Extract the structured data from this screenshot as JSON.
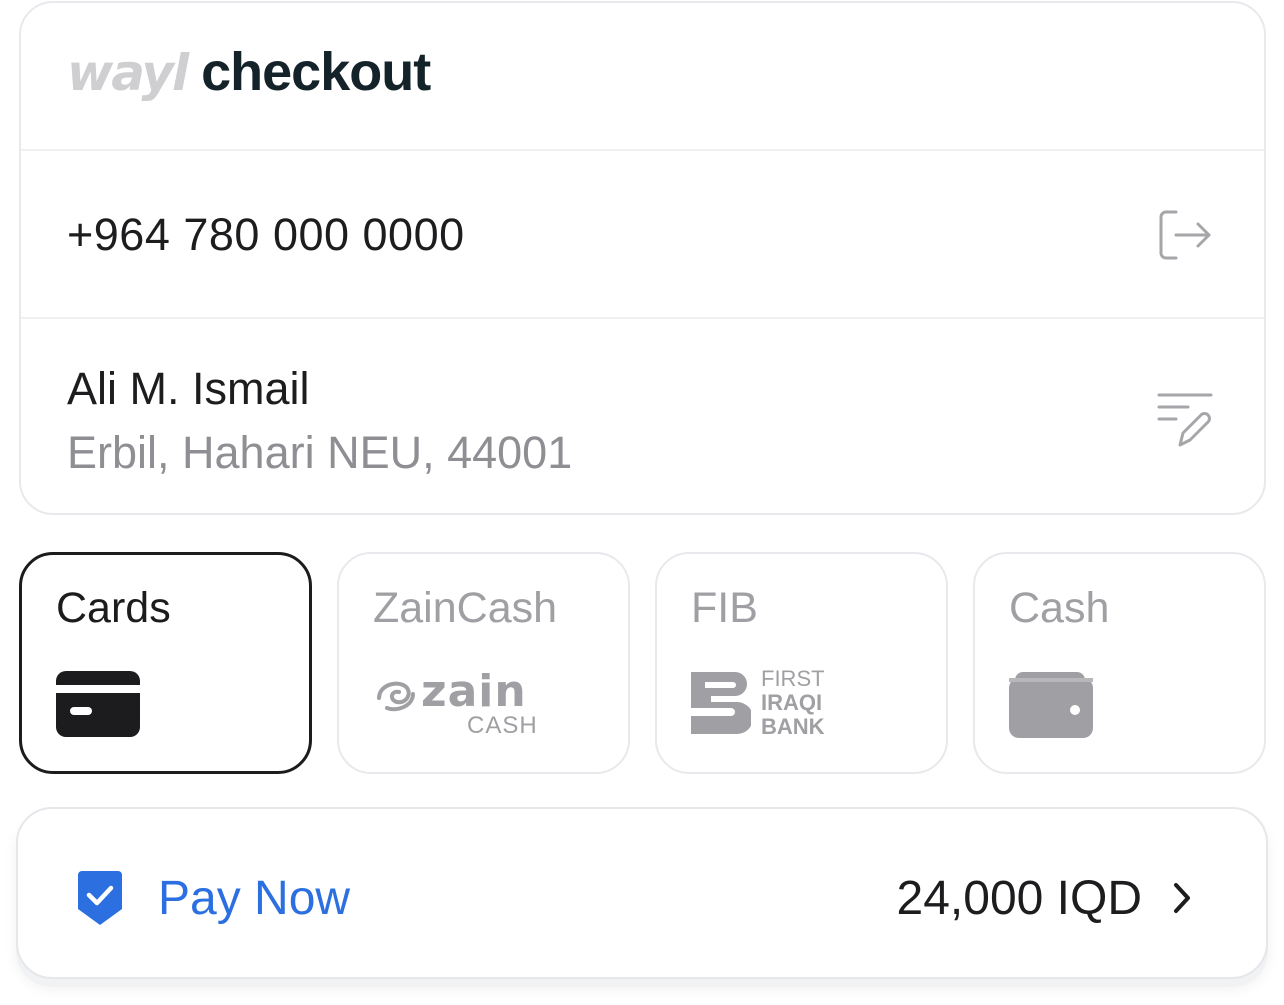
{
  "header": {
    "logo_text": "wayl",
    "title": "checkout"
  },
  "account": {
    "phone": "+964 780 000 0000",
    "logout_icon": "logout-icon"
  },
  "address": {
    "name": "Ali M. Ismail",
    "line": "Erbil, Hahari NEU, 44001",
    "edit_icon": "edit-list-icon"
  },
  "payment_methods": [
    {
      "label": "Cards",
      "selected": true,
      "icon": "credit-card-icon"
    },
    {
      "label": "ZainCash",
      "selected": false,
      "icon": "zaincash-logo",
      "logo_word": "zain",
      "logo_sub": "CASH"
    },
    {
      "label": "FIB",
      "selected": false,
      "icon": "fib-logo",
      "logo_lines": [
        "FIRST",
        "IRAQI",
        "BANK"
      ]
    },
    {
      "label": "Cash",
      "selected": false,
      "icon": "wallet-icon"
    }
  ],
  "pay": {
    "label": "Pay Now",
    "amount": "24,000 IQD",
    "shield_icon": "shield-check-icon",
    "chevron_icon": "chevron-right-icon"
  },
  "colors": {
    "accent": "#2b6fe0",
    "muted": "#a0a0a4",
    "dark": "#1c1c1e"
  }
}
